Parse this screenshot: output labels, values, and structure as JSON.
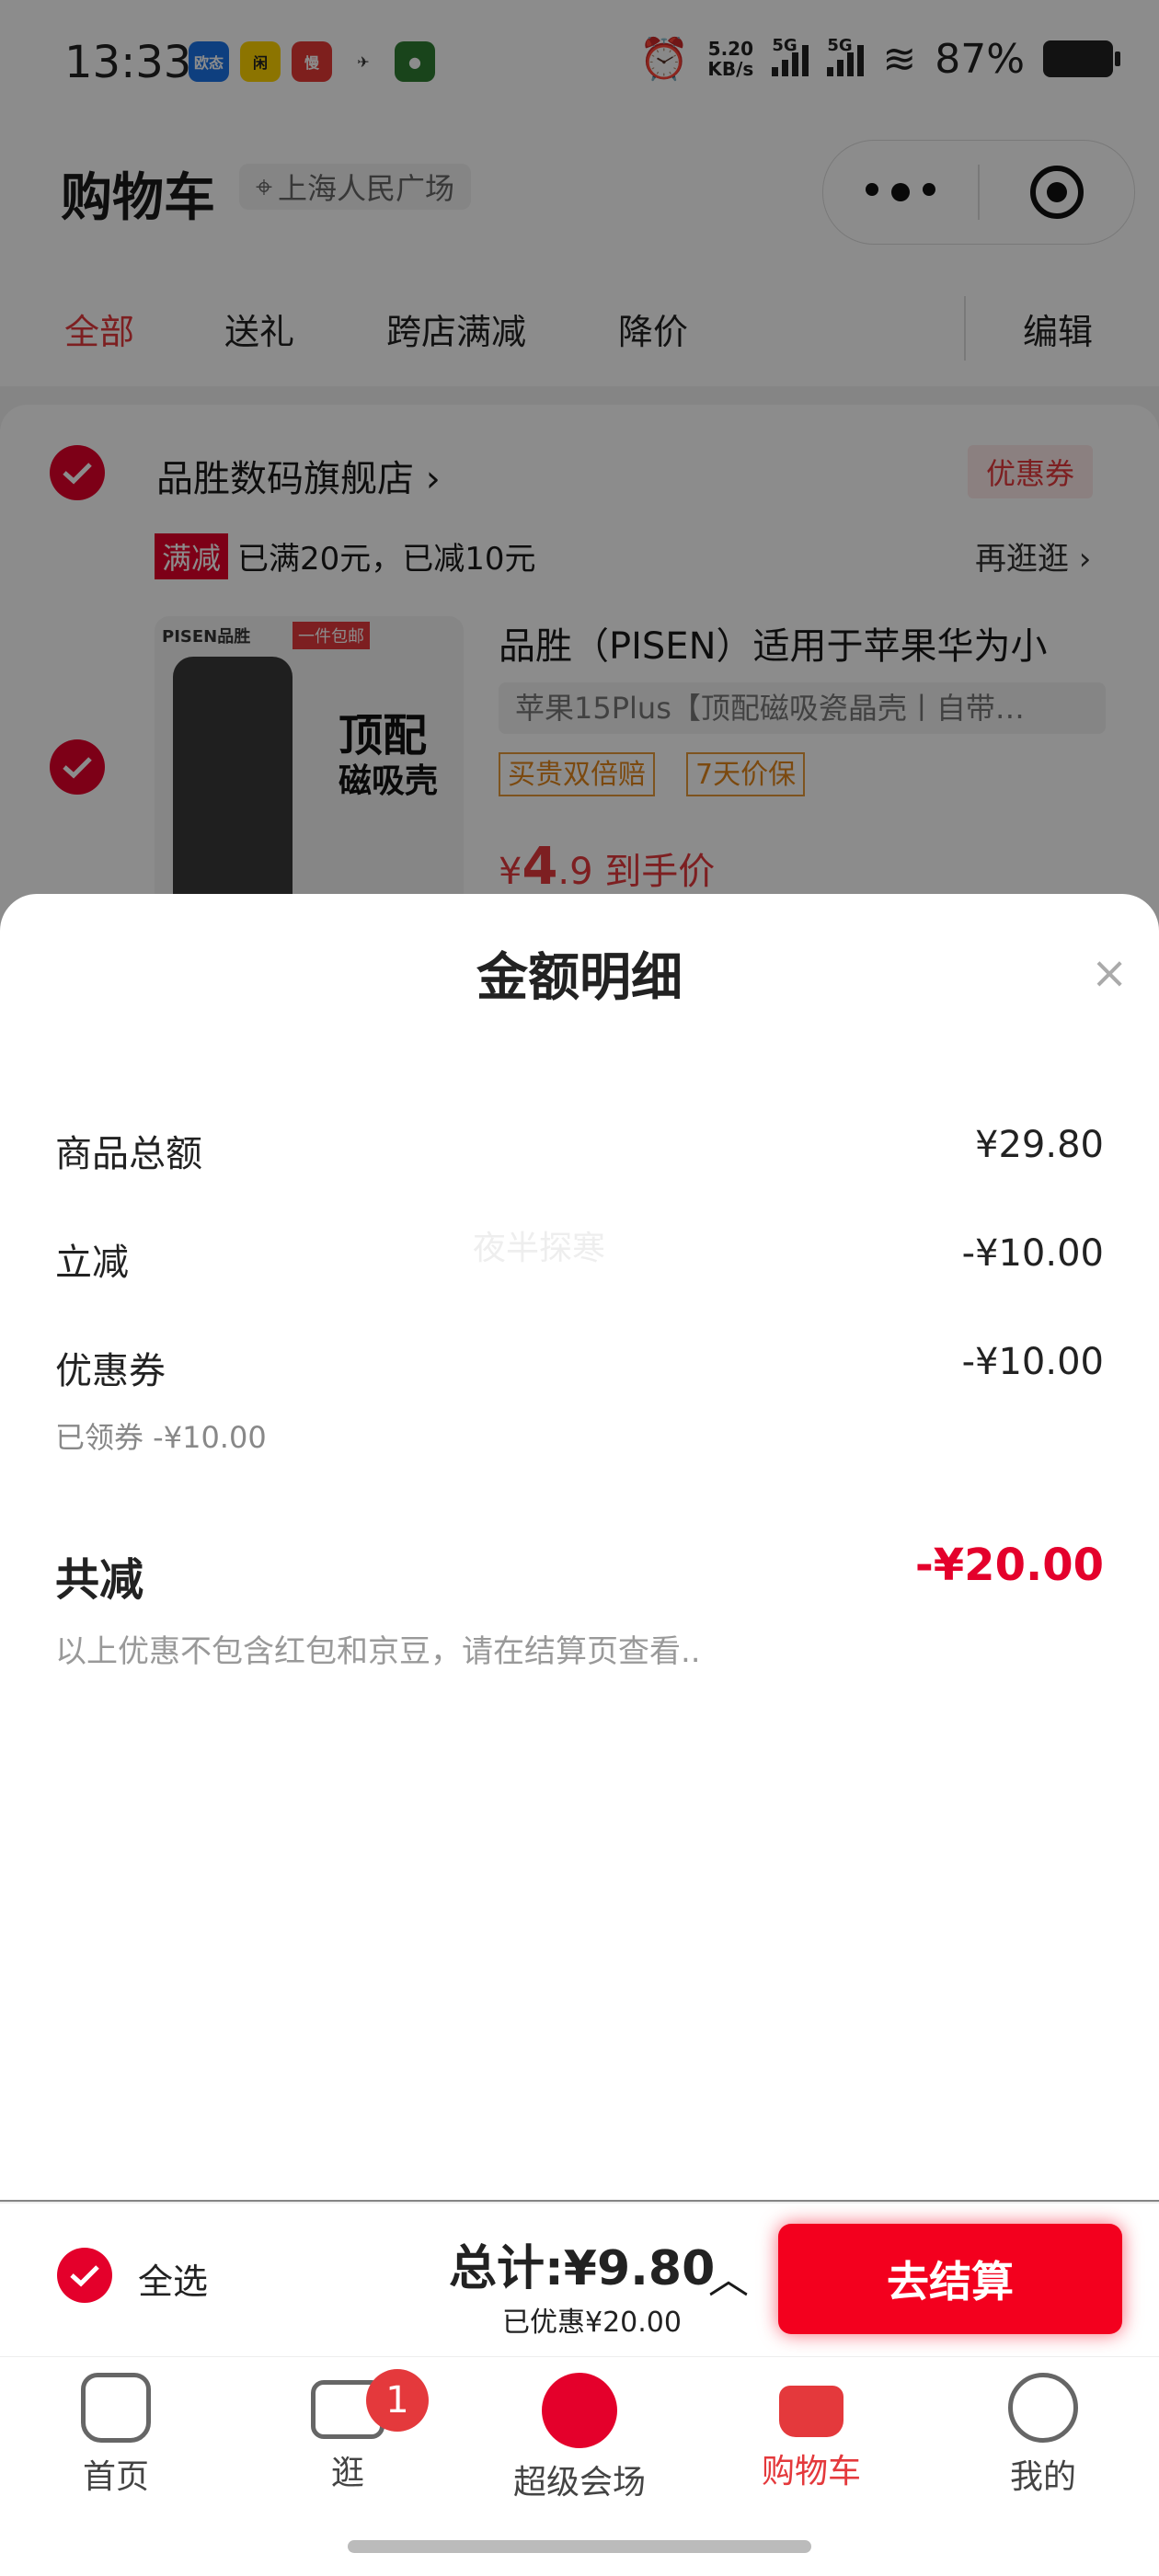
{
  "status_bar": {
    "time": "13:33",
    "app_icons": [
      {
        "name": "欧态",
        "color": "#1a73e8"
      },
      {
        "name": "闲鱼",
        "color": "#ffd400"
      },
      {
        "name": "慢",
        "color": "#e53935"
      },
      {
        "name": "bird",
        "color": "#333333"
      },
      {
        "name": "avatar",
        "color": "#2e7d32"
      }
    ],
    "net_speed": "5.20",
    "net_unit": "KB/s",
    "signal1": "5G",
    "signal2": "5G",
    "battery": "87%"
  },
  "header": {
    "title": "购物车",
    "location": "上海人民广场"
  },
  "tabs": [
    "全部",
    "送礼",
    "跨店满减",
    "降价"
  ],
  "edit_label": "编辑",
  "store": {
    "name": "品胜数码旗舰店 ›",
    "coupon": "优惠券",
    "promo_tag": "满减",
    "promo_text": "已满20元，已减10元",
    "more": "再逛逛 ›"
  },
  "product": {
    "title": "品胜（PISEN）适用于苹果华为小",
    "spec": "苹果15Plus【顶配磁吸瓷晶壳丨自带…",
    "tags": [
      "买贵双倍赔",
      "7天价保"
    ],
    "price_prefix": "¥",
    "price_big": "4",
    "price_small": ".9",
    "price_suffix": "到手价",
    "thumb_brand": "PISEN品胜",
    "thumb_badge": "一件包邮",
    "thumb_line1": "顶配",
    "thumb_line2": "磁吸壳"
  },
  "sheet": {
    "title": "金额明细",
    "close": "×",
    "rows": [
      {
        "label": "商品总额",
        "value": "¥29.80"
      },
      {
        "label": "立减",
        "value": "-¥10.00"
      },
      {
        "label": "优惠券",
        "value": "-¥10.00"
      }
    ],
    "coupon_sub": "已领券 -¥10.00",
    "watermark": "夜半探寒",
    "total_label": "共减",
    "total_value": "-¥20.00",
    "note": "以上优惠不包含红包和京豆，请在结算页查看.."
  },
  "checkout": {
    "select_all": "全选",
    "total": "总计:¥9.80",
    "saved": "已优惠¥20.00",
    "pay": "去结算"
  },
  "tabbar": [
    {
      "label": "首页",
      "icon": "home-icon"
    },
    {
      "label": "逛",
      "icon": "video-icon",
      "badge": "1"
    },
    {
      "label": "超级会场",
      "icon": "super-venue-icon"
    },
    {
      "label": "购物车",
      "icon": "cart-icon"
    },
    {
      "label": "我的",
      "icon": "profile-icon"
    }
  ],
  "colors": {
    "accent": "#e4393c",
    "pay": "#f3001e"
  }
}
